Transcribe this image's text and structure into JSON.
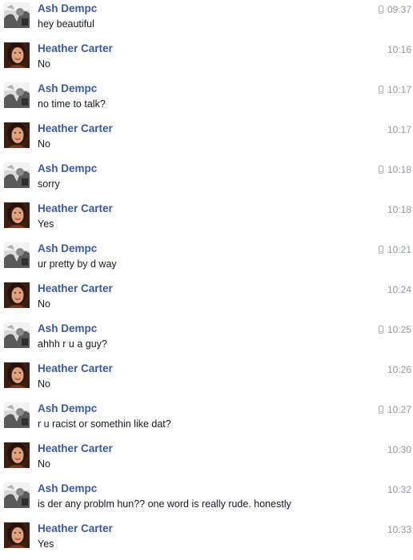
{
  "messages": [
    {
      "sender": "Ash Dempc",
      "text": "hey beautiful",
      "time": "09:37",
      "avatar": "ash",
      "mobile_icon": "phone-icon"
    },
    {
      "sender": "Heather Carter",
      "text": "No",
      "time": "10:16",
      "avatar": "heather",
      "mobile_icon": null
    },
    {
      "sender": "Ash Dempc",
      "text": "no time to talk?",
      "time": "10:17",
      "avatar": "ash",
      "mobile_icon": "phone-icon"
    },
    {
      "sender": "Heather Carter",
      "text": "No",
      "time": "10:17",
      "avatar": "heather",
      "mobile_icon": null
    },
    {
      "sender": "Ash Dempc",
      "text": "sorry",
      "time": "10:18",
      "avatar": "ash",
      "mobile_icon": "phone-icon"
    },
    {
      "sender": "Heather Carter",
      "text": "Yes",
      "time": "10:18",
      "avatar": "heather",
      "mobile_icon": null
    },
    {
      "sender": "Ash Dempc",
      "text": "ur pretty by d way",
      "time": "10:21",
      "avatar": "ash",
      "mobile_icon": "phone-icon"
    },
    {
      "sender": "Heather Carter",
      "text": "No",
      "time": "10:24",
      "avatar": "heather",
      "mobile_icon": null
    },
    {
      "sender": "Ash Dempc",
      "text": "ahhh r u a guy?",
      "time": "10:25",
      "avatar": "ash",
      "mobile_icon": "phone-icon"
    },
    {
      "sender": "Heather Carter",
      "text": "No",
      "time": "10:26",
      "avatar": "heather",
      "mobile_icon": null
    },
    {
      "sender": "Ash Dempc",
      "text": "r u racist or somethin like dat?",
      "time": "10:27",
      "avatar": "ash",
      "mobile_icon": "phone-icon"
    },
    {
      "sender": "Heather Carter",
      "text": "No",
      "time": "10:30",
      "avatar": "heather",
      "mobile_icon": null
    },
    {
      "sender": "Ash Dempc",
      "text": "is der any problm hun?? one word is really rude. honestly",
      "time": "10:32",
      "avatar": "ash",
      "mobile_icon": null
    },
    {
      "sender": "Heather Carter",
      "text": "Yes",
      "time": "10:33",
      "avatar": "heather",
      "mobile_icon": null
    }
  ],
  "colors": {
    "sender_name": "#3b5998",
    "message_text": "#141823",
    "timestamp": "#9197a3",
    "icon": "#a9aeb8"
  }
}
